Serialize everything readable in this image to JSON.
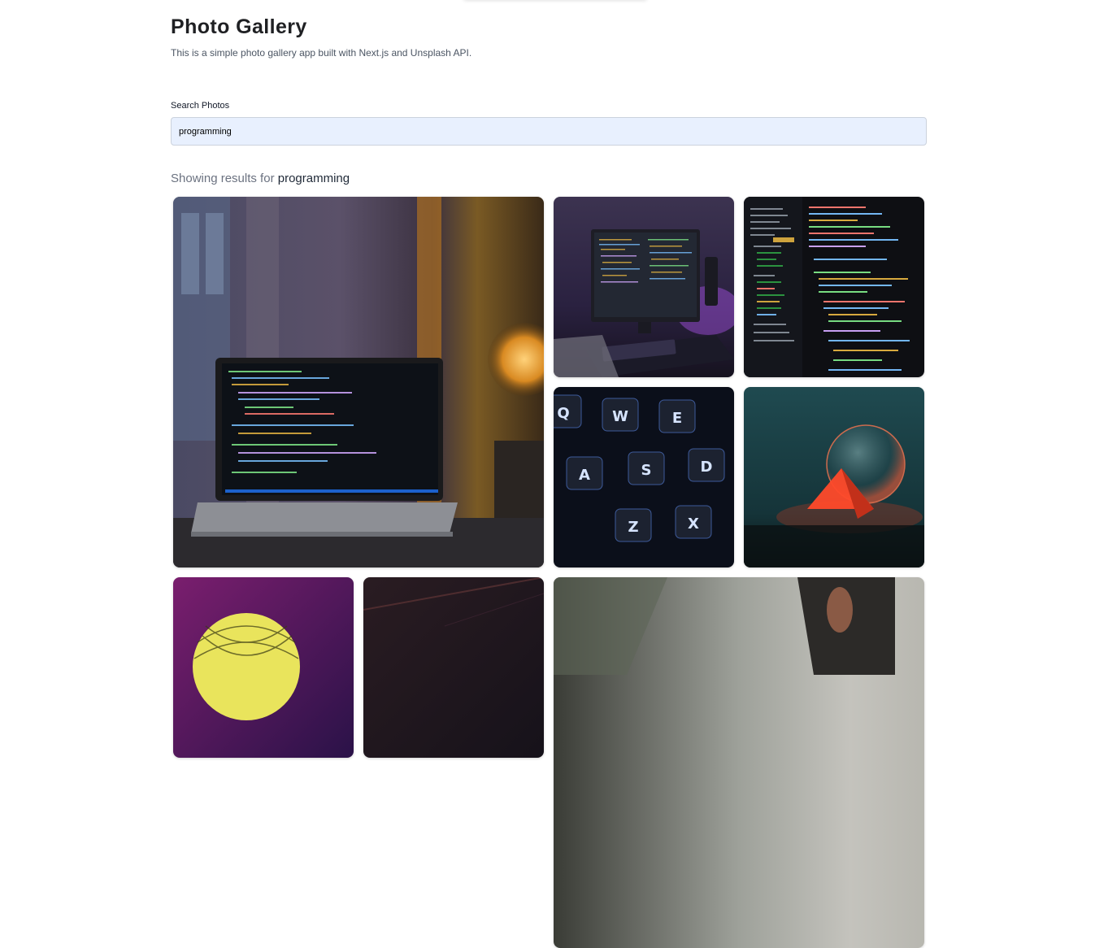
{
  "header": {
    "title": "Photo Gallery",
    "subtitle": "This is a simple photo gallery app built with Next.js and Unsplash API."
  },
  "search": {
    "label": "Search Photos",
    "value": "programming"
  },
  "results": {
    "prefix": "Showing results for ",
    "query": "programming"
  },
  "photos": [
    {
      "name": "photo-laptop-lamp"
    },
    {
      "name": "photo-desktop-monitor"
    },
    {
      "name": "photo-code-editor"
    },
    {
      "name": "photo-keyboard-keys"
    },
    {
      "name": "photo-glass-sphere"
    },
    {
      "name": "photo-yellow-sphere"
    },
    {
      "name": "photo-dark-abstract"
    },
    {
      "name": "photo-person-portrait"
    }
  ],
  "keyboard_letters": [
    "Q",
    "W",
    "E",
    "A",
    "S",
    "D",
    "Z",
    "X"
  ]
}
